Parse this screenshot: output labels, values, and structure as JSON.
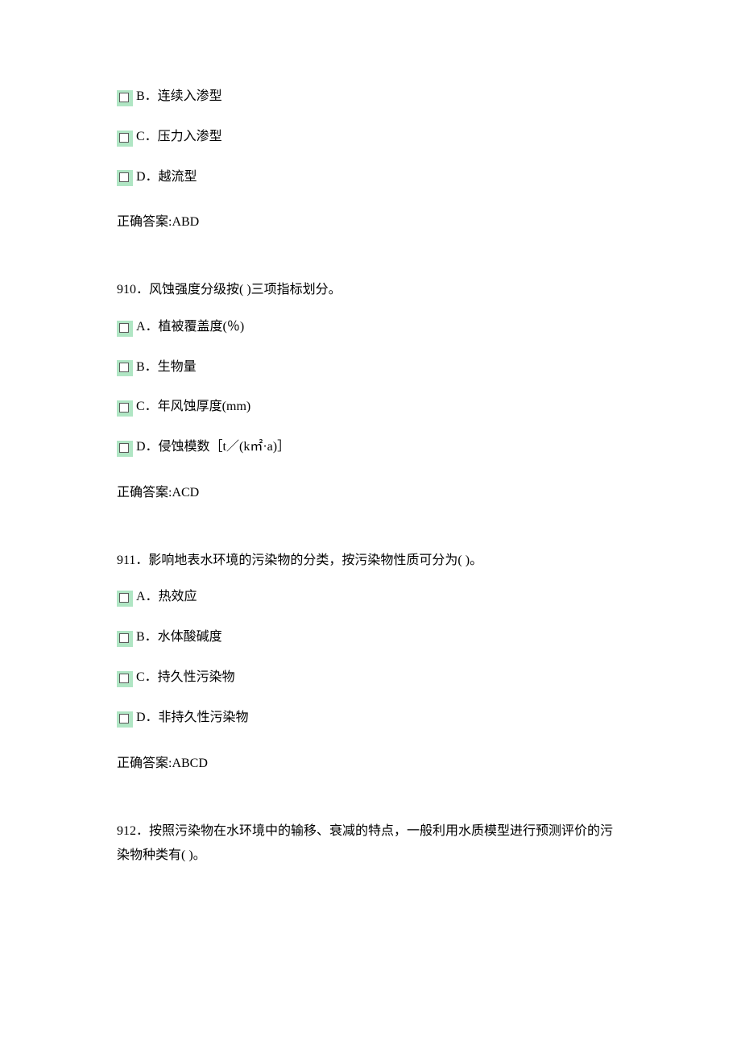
{
  "blocks": [
    {
      "id": "q909-tail",
      "options": [
        {
          "label": "B",
          "text": "连续入渗型"
        },
        {
          "label": "C",
          "text": "压力入渗型"
        },
        {
          "label": "D",
          "text": "越流型"
        }
      ],
      "answer": "正确答案:ABD"
    },
    {
      "id": "q910",
      "question": "910．风蚀强度分级按(  )三项指标划分。",
      "options": [
        {
          "label": "A",
          "text": "植被覆盖度(％)"
        },
        {
          "label": "B",
          "text": "生物量"
        },
        {
          "label": "C",
          "text": "年风蚀厚度(mm)"
        },
        {
          "label": "D",
          "text": "侵蚀模数［t／(k㎡·a)］"
        }
      ],
      "answer": "正确答案:ACD"
    },
    {
      "id": "q911",
      "question": "911．影响地表水环境的污染物的分类，按污染物性质可分为(  )。",
      "options": [
        {
          "label": "A",
          "text": "热效应"
        },
        {
          "label": "B",
          "text": "水体酸碱度"
        },
        {
          "label": "C",
          "text": "持久性污染物"
        },
        {
          "label": "D",
          "text": "非持久性污染物"
        }
      ],
      "answer": "正确答案:ABCD"
    },
    {
      "id": "q912",
      "question": "912．按照污染物在水环境中的输移、衰减的特点，一般利用水质模型进行预测评价的污染物种类有(     )。"
    }
  ]
}
